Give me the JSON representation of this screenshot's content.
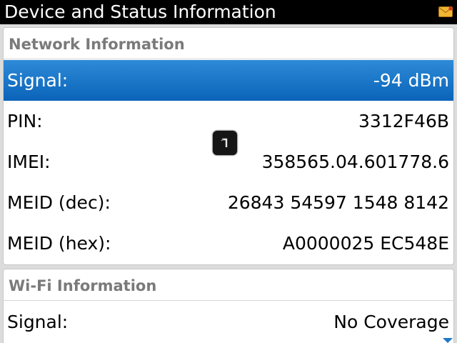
{
  "title_bar": {
    "title": "Device and Status Information",
    "notification_icon": "mail-icon"
  },
  "network": {
    "header": "Network Information",
    "rows": [
      {
        "label": "Signal:",
        "value": "-94 dBm",
        "selected": true
      },
      {
        "label": "PIN:",
        "value": "3312F46B"
      },
      {
        "label": "IMEI:",
        "value": "358565.04.601778.6"
      },
      {
        "label": "MEID (dec):",
        "value": "26843 54597 1548 8142"
      },
      {
        "label": "MEID (hex):",
        "value": "A0000025 EC548E"
      }
    ]
  },
  "wifi": {
    "header": "Wi-Fi Information",
    "rows": [
      {
        "label": "Signal:",
        "value": "No Coverage"
      }
    ]
  },
  "colors": {
    "title_bar": "#000000",
    "selection": "#1a73c8",
    "section_header_text": "#7a7a7a",
    "background": "#dcdcdc"
  },
  "icons": {
    "cursor": "trackpad-cursor-icon",
    "scroll": "scroll-down-arrow-icon"
  }
}
